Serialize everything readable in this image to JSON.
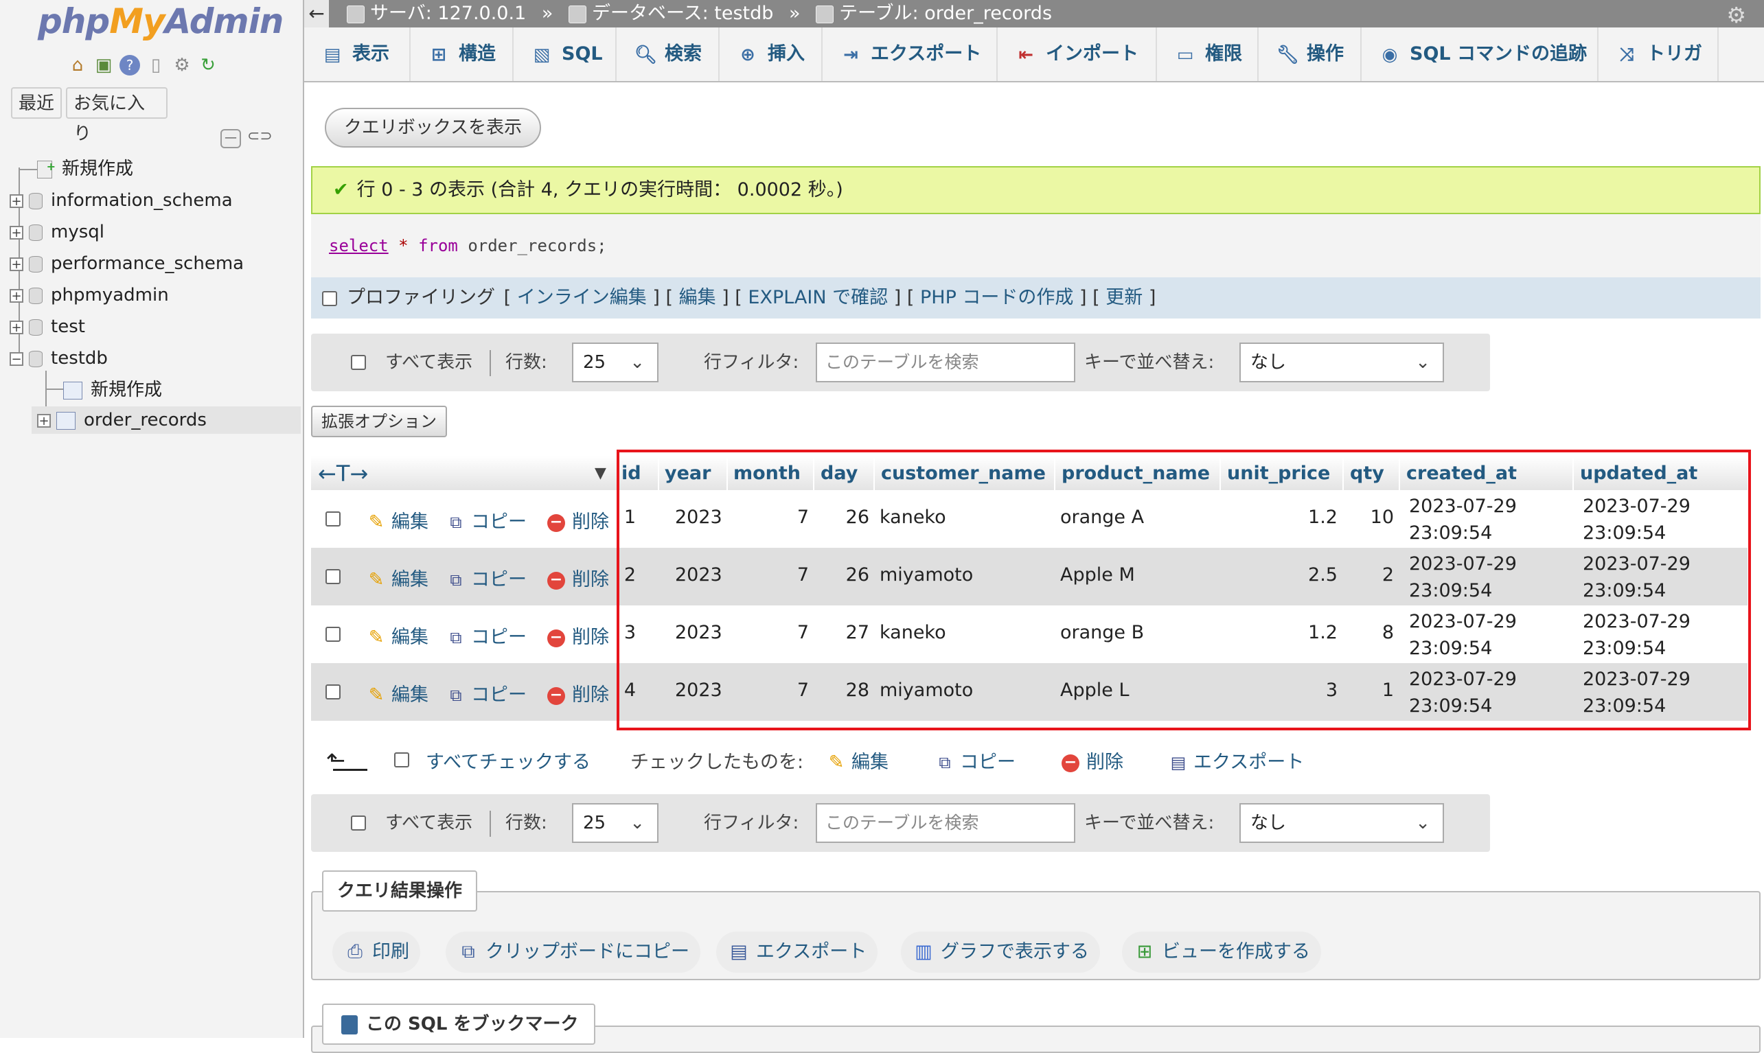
{
  "sidebar": {
    "logo": {
      "php": "php",
      "my": "My",
      "admin": "Admin"
    },
    "nav_icons": [
      "home-icon",
      "exit-icon",
      "help-icon",
      "docs-icon",
      "settings-icon",
      "reload-icon"
    ],
    "recent_label": "最近",
    "favorites_label": "お気に入り",
    "tree": [
      {
        "label": "新規作成",
        "type": "new"
      },
      {
        "label": "information_schema",
        "type": "db"
      },
      {
        "label": "mysql",
        "type": "db"
      },
      {
        "label": "performance_schema",
        "type": "db"
      },
      {
        "label": "phpmyadmin",
        "type": "db"
      },
      {
        "label": "test",
        "type": "db"
      },
      {
        "label": "testdb",
        "type": "db",
        "expanded": true
      },
      {
        "label": "新規作成",
        "type": "new-table"
      },
      {
        "label": "order_records",
        "type": "table"
      }
    ]
  },
  "breadcrumb": {
    "server": "サーバ: 127.0.0.1",
    "database": "データベース: testdb",
    "table": "テーブル: order_records",
    "separator": "»"
  },
  "tabs": [
    {
      "label": "表示",
      "icon": "browse-icon"
    },
    {
      "label": "構造",
      "icon": "structure-icon"
    },
    {
      "label": "SQL",
      "icon": "sql-icon"
    },
    {
      "label": "検索",
      "icon": "search-icon"
    },
    {
      "label": "挿入",
      "icon": "insert-icon"
    },
    {
      "label": "エクスポート",
      "icon": "export-icon"
    },
    {
      "label": "インポート",
      "icon": "import-icon"
    },
    {
      "label": "権限",
      "icon": "privileges-icon"
    },
    {
      "label": "操作",
      "icon": "operations-icon"
    },
    {
      "label": "SQL コマンドの追跡",
      "icon": "tracking-icon"
    },
    {
      "label": "トリガ",
      "icon": "triggers-icon"
    }
  ],
  "query_box_button": "クエリボックスを表示",
  "success_message": "行 0 - 3 の表示 (合計 4, クエリの実行時間： 0.0002 秒。)",
  "sql": {
    "kw1": "select",
    "star": "*",
    "kw2": "from",
    "rest": "order_records;"
  },
  "profiling": {
    "label": "プロファイリング",
    "links": [
      "インライン編集",
      "編集",
      "EXPLAIN で確認",
      "PHP コードの作成",
      "更新"
    ],
    "open": "[",
    "close": "]",
    "mid": "] ["
  },
  "navigation": {
    "show_all": "すべて表示",
    "rows_label": "行数:",
    "rows_value": "25",
    "filter_label": "行フィルタ:",
    "filter_placeholder": "このテーブルを検索",
    "sort_label": "キーで並べ替え:",
    "sort_value": "なし"
  },
  "options_button": "拡張オプション",
  "table": {
    "columns": [
      "id",
      "year",
      "month",
      "day",
      "customer_name",
      "product_name",
      "unit_price",
      "qty",
      "created_at",
      "updated_at"
    ],
    "actions": {
      "edit": "編集",
      "copy": "コピー",
      "delete": "削除"
    },
    "rows": [
      {
        "id": "1",
        "year": "2023",
        "month": "7",
        "day": "26",
        "customer_name": "kaneko",
        "product_name": "orange A",
        "unit_price": "1.2",
        "qty": "10",
        "created_date": "2023-07-29",
        "created_time": "23:09:54",
        "updated_date": "2023-07-29",
        "updated_time": "23:09:54"
      },
      {
        "id": "2",
        "year": "2023",
        "month": "7",
        "day": "26",
        "customer_name": "miyamoto",
        "product_name": "Apple M",
        "unit_price": "2.5",
        "qty": "2",
        "created_date": "2023-07-29",
        "created_time": "23:09:54",
        "updated_date": "2023-07-29",
        "updated_time": "23:09:54"
      },
      {
        "id": "3",
        "year": "2023",
        "month": "7",
        "day": "27",
        "customer_name": "kaneko",
        "product_name": "orange B",
        "unit_price": "1.2",
        "qty": "8",
        "created_date": "2023-07-29",
        "created_time": "23:09:54",
        "updated_date": "2023-07-29",
        "updated_time": "23:09:54"
      },
      {
        "id": "4",
        "year": "2023",
        "month": "7",
        "day": "28",
        "customer_name": "miyamoto",
        "product_name": "Apple L",
        "unit_price": "3",
        "qty": "1",
        "created_date": "2023-07-29",
        "created_time": "23:09:54",
        "updated_date": "2023-07-29",
        "updated_time": "23:09:54"
      }
    ]
  },
  "bulk": {
    "check_all": "すべてチェックする",
    "with_selected": "チェックしたものを:",
    "edit": "編集",
    "copy": "コピー",
    "delete": "削除",
    "export": "エクスポート"
  },
  "query_ops": {
    "legend": "クエリ結果操作",
    "print": "印刷",
    "clipboard": "クリップボードにコピー",
    "export": "エクスポート",
    "chart": "グラフで表示する",
    "view": "ビューを作成する"
  },
  "bookmark_legend": "この SQL をブックマーク",
  "colors": {
    "link": "#235a81",
    "success_bg": "#ebf8a4",
    "highlight_border": "#e8141b"
  }
}
